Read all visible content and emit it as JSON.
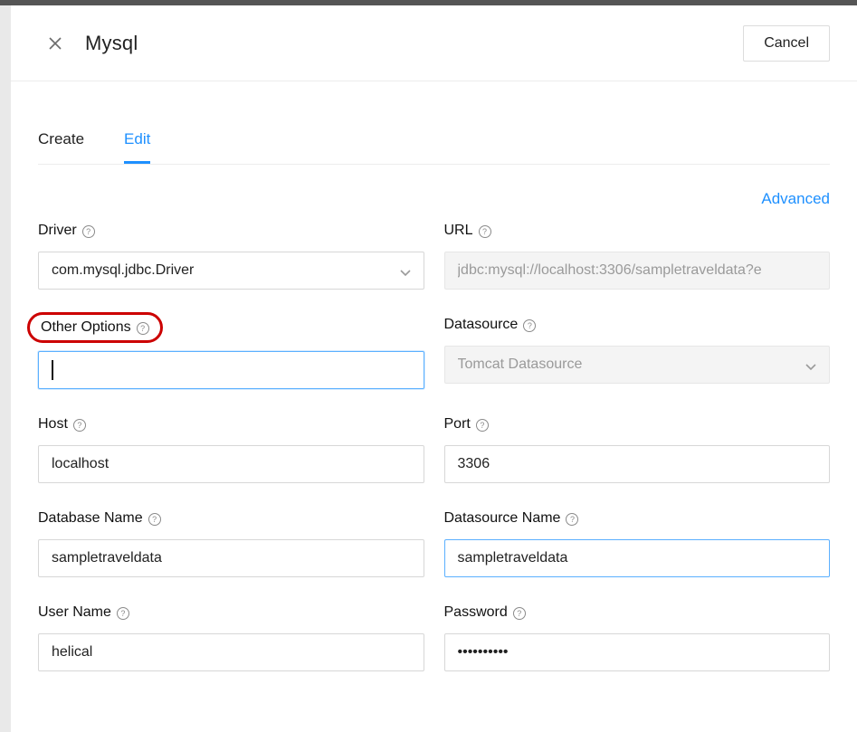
{
  "header": {
    "title": "Mysql",
    "cancel_label": "Cancel"
  },
  "tabs": {
    "create": "Create",
    "edit": "Edit",
    "active": "edit"
  },
  "advanced_label": "Advanced",
  "fields": {
    "driver": {
      "label": "Driver",
      "value": "com.mysql.jdbc.Driver"
    },
    "url": {
      "label": "URL",
      "value": "jdbc:mysql://localhost:3306/sampletraveldata?e"
    },
    "other_options": {
      "label": "Other Options",
      "value": ""
    },
    "datasource": {
      "label": "Datasource",
      "value": "Tomcat Datasource"
    },
    "host": {
      "label": "Host",
      "value": "localhost"
    },
    "port": {
      "label": "Port",
      "value": "3306"
    },
    "db_name": {
      "label": "Database Name",
      "value": "sampletraveldata"
    },
    "ds_name": {
      "label": "Datasource Name",
      "value": "sampletraveldata"
    },
    "user_name": {
      "label": "User Name",
      "value": "helical"
    },
    "password": {
      "label": "Password",
      "value": "••••••••••"
    }
  }
}
